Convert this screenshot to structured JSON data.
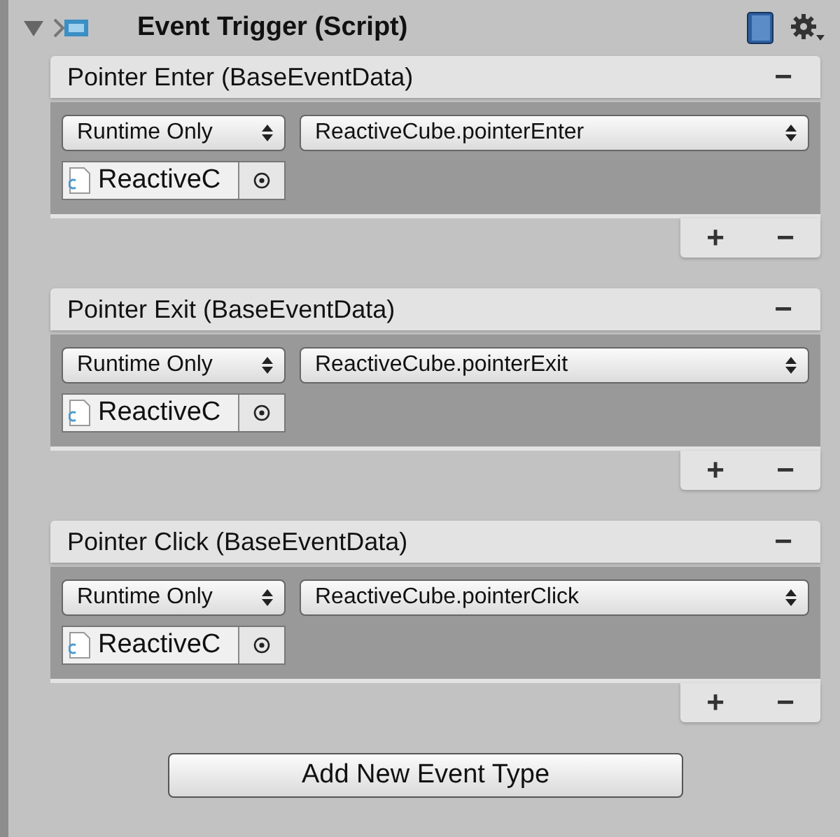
{
  "component": {
    "title": "Event Trigger (Script)",
    "expanded": true
  },
  "events": [
    {
      "name": "Pointer Enter (BaseEventData)",
      "remove": "−",
      "mode": "Runtime Only",
      "function": "ReactiveCube.pointerEnter",
      "target": "ReactiveC",
      "add": "+",
      "remove_listener": "−"
    },
    {
      "name": "Pointer Exit (BaseEventData)",
      "remove": "−",
      "mode": "Runtime Only",
      "function": "ReactiveCube.pointerExit",
      "target": "ReactiveC",
      "add": "+",
      "remove_listener": "−"
    },
    {
      "name": "Pointer Click (BaseEventData)",
      "remove": "−",
      "mode": "Runtime Only",
      "function": "ReactiveCube.pointerClick",
      "target": "ReactiveC",
      "add": "+",
      "remove_listener": "−"
    }
  ],
  "add_button": "Add New Event Type"
}
